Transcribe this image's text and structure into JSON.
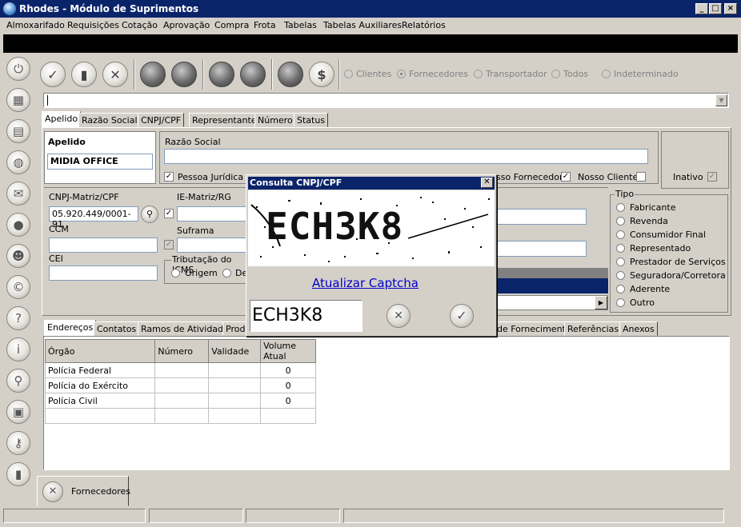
{
  "window": {
    "title": "Rhodes - Módulo de Suprimentos",
    "controls": [
      "_",
      "□",
      "×"
    ]
  },
  "menu": [
    "Almoxarifado",
    "Requisições",
    "Cotação",
    "Aprovação",
    "Compra",
    "Frota",
    "Tabelas",
    "Tabelas Auxiliares",
    "Relatórios"
  ],
  "toolbar": {
    "filters": [
      "Clientes",
      "Fornecedores",
      "Transportador",
      "Todos",
      "Indeterminado"
    ],
    "selected_filter": "Fornecedores",
    "dollar": "$"
  },
  "search_tabs": [
    "Apelido",
    "Razão Social",
    "CNPJ/CPF",
    "Representante",
    "Número",
    "Status"
  ],
  "form": {
    "apelido_label": "Apelido",
    "apelido_value": "MIDIA OFFICE",
    "razao_social_label": "Razão Social",
    "razao_social_value": "",
    "pessoa_juridica_label": "Pessoa Jurídica",
    "nosso_fornecedor_label": "Nosso Fornecedor",
    "nosso_fornecedor_visible": "sso Fornecedor",
    "nosso_cliente_label": "Nosso Cliente",
    "inativo_label": "Inativo",
    "cnpj_label": "CNPJ-Matriz/CPF",
    "cnpj_value": "05.920.449/0001-91",
    "ie_label": "IE-Matriz/RG",
    "ccm_label": "CCM",
    "suframa_label": "Suframa",
    "cei_label": "CEI",
    "tributacao_label": "Tributação do ICMS",
    "tributacao_options": [
      "Origem",
      "De"
    ]
  },
  "tipo": {
    "label": "Tipo",
    "options": [
      "Fabricante",
      "Revenda",
      "Consumidor Final",
      "Representado",
      "Prestador de Serviços",
      "Seguradora/Corretora",
      "Aderente",
      "Outro"
    ]
  },
  "bottom_tabs": {
    "left": [
      "Endereços",
      "Contatos",
      "Ramos de Atividade",
      "Prod"
    ],
    "right": [
      "de Fornecimento",
      "Referências",
      "Anexos"
    ]
  },
  "table": {
    "columns": [
      "Órgão",
      "Número",
      "Validade",
      "Volume Atual"
    ],
    "rows": [
      {
        "orgao": "Polícia Federal",
        "numero": "",
        "validade": "",
        "volume": "0"
      },
      {
        "orgao": "Polícia do Exército",
        "numero": "",
        "validade": "",
        "volume": "0"
      },
      {
        "orgao": "Polícia Civil",
        "numero": "",
        "validade": "",
        "volume": "0"
      }
    ]
  },
  "dialog": {
    "title": "Consulta CNPJ/CPF",
    "captcha_image_text": "ECH3K8",
    "refresh_link": "Atualizar Captcha",
    "captcha_input": "ECH3K8"
  },
  "task_tab": {
    "label": "Fornecedores"
  },
  "colors": {
    "titlebar": "#0a246a",
    "face": "#d4d0c8",
    "link": "#0000cc",
    "grid_selection": "#0a246a"
  },
  "icons": {
    "sidebar": [
      "power-icon",
      "calculator-icon",
      "table-icon",
      "globe-icon",
      "mail-icon",
      "chat-icon",
      "user-icon",
      "copyright-icon",
      "help-icon",
      "info-icon",
      "search-icon",
      "camera-icon",
      "key-icon",
      "battery-icon"
    ],
    "toolbar": [
      "confirm-icon",
      "document-icon",
      "cancel-icon",
      "dark-circle-icon",
      "dollar-icon"
    ]
  }
}
